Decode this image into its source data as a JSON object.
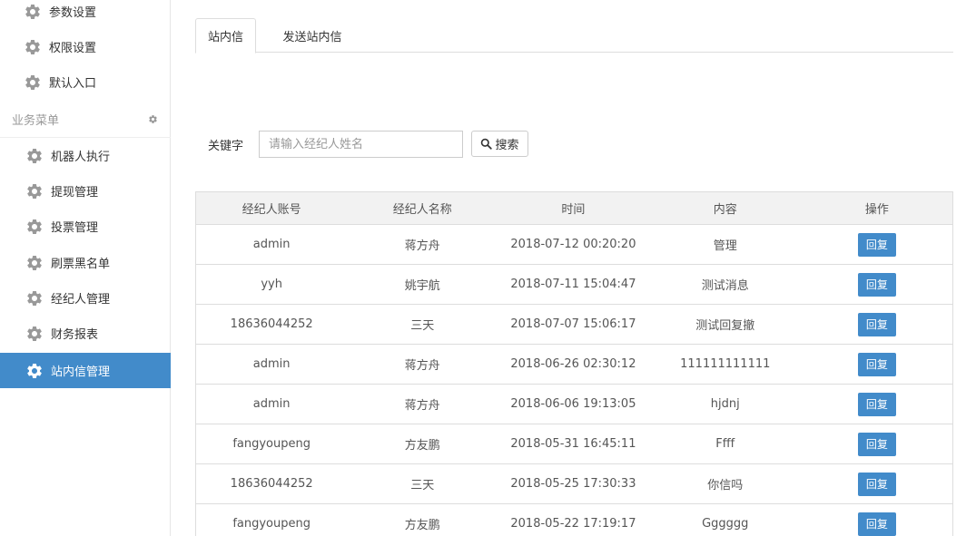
{
  "sidebar": {
    "top_items": [
      {
        "label": "参数设置"
      },
      {
        "label": "权限设置"
      },
      {
        "label": "默认入口"
      }
    ],
    "group_title": "业务菜单",
    "business_items": [
      {
        "label": "机器人执行"
      },
      {
        "label": "提现管理"
      },
      {
        "label": "投票管理"
      },
      {
        "label": "刷票黑名单"
      },
      {
        "label": "经纪人管理"
      },
      {
        "label": "财务报表"
      },
      {
        "label": "站内信管理",
        "active": true
      }
    ]
  },
  "tabs": [
    {
      "label": "站内信",
      "active": true
    },
    {
      "label": "发送站内信"
    }
  ],
  "search": {
    "label": "关键字",
    "placeholder": "请输入经纪人姓名",
    "button_label": "搜索"
  },
  "table": {
    "headers": [
      "经纪人账号",
      "经纪人名称",
      "时间",
      "内容",
      "操作"
    ],
    "rows": [
      {
        "account": "admin",
        "name": "蒋方舟",
        "time": "2018-07-12 00:20:20",
        "content": "管理",
        "action": "回复"
      },
      {
        "account": "yyh",
        "name": "姚宇航",
        "time": "2018-07-11 15:04:47",
        "content": "测试消息",
        "action": "回复"
      },
      {
        "account": "18636044252",
        "name": "三天",
        "time": "2018-07-07 15:06:17",
        "content": "测试回复撤",
        "action": "回复"
      },
      {
        "account": "admin",
        "name": "蒋方舟",
        "time": "2018-06-26 02:30:12",
        "content": "111111111111",
        "action": "回复"
      },
      {
        "account": "admin",
        "name": "蒋方舟",
        "time": "2018-06-06 19:13:05",
        "content": "hjdnj",
        "action": "回复"
      },
      {
        "account": "fangyoupeng",
        "name": "方友鹏",
        "time": "2018-05-31 16:45:11",
        "content": "Ffff",
        "action": "回复"
      },
      {
        "account": "18636044252",
        "name": "三天",
        "time": "2018-05-25 17:30:33",
        "content": "你信吗",
        "action": "回复"
      },
      {
        "account": "fangyoupeng",
        "name": "方友鹏",
        "time": "2018-05-22 17:19:17",
        "content": "Gggggg",
        "action": "回复"
      }
    ]
  },
  "colors": {
    "accent": "#428bca",
    "gear": "#999999"
  }
}
